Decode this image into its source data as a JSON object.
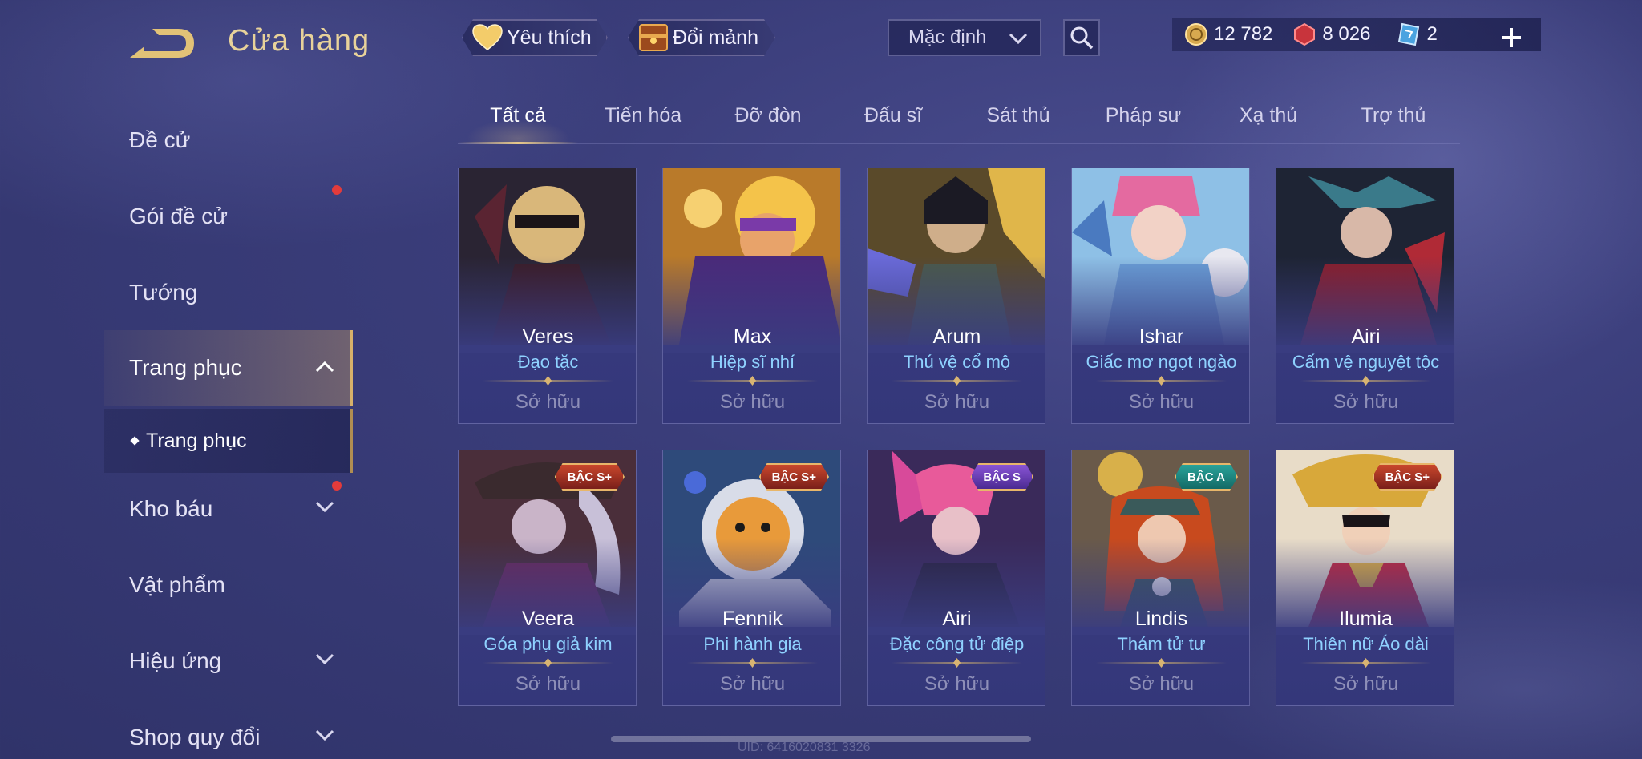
{
  "header": {
    "title": "Cửa hàng",
    "favorite_label": "Yêu thích",
    "swap_label": "Đổi mảnh",
    "sort_value": "Mặc định"
  },
  "currency": {
    "gold": "12 782",
    "red": "8 026",
    "ticket": "2"
  },
  "sidebar": {
    "items": [
      {
        "label": "Đề cử"
      },
      {
        "label": "Gói đề cử"
      },
      {
        "label": "Tướng"
      },
      {
        "label": "Trang phục"
      },
      {
        "label": "Kho báu"
      },
      {
        "label": "Vật phẩm"
      },
      {
        "label": "Hiệu ứng"
      },
      {
        "label": "Shop quy đổi"
      }
    ],
    "sub_item": "Trang phục"
  },
  "tabs": [
    "Tất cả",
    "Tiến hóa",
    "Đỡ đòn",
    "Đấu sĩ",
    "Sát thủ",
    "Pháp sư",
    "Xạ thủ",
    "Trợ thủ"
  ],
  "cards": [
    {
      "hero": "Veres",
      "skin": "Đạo tặc",
      "status": "Sở hữu",
      "tier": ""
    },
    {
      "hero": "Max",
      "skin": "Hiệp sĩ nhí",
      "status": "Sở hữu",
      "tier": ""
    },
    {
      "hero": "Arum",
      "skin": "Thú vệ cổ mộ",
      "status": "Sở hữu",
      "tier": ""
    },
    {
      "hero": "Ishar",
      "skin": "Giấc mơ ngọt ngào",
      "status": "Sở hữu",
      "tier": ""
    },
    {
      "hero": "Airi",
      "skin": "Cấm vệ nguyệt tộc",
      "status": "Sở hữu",
      "tier": ""
    },
    {
      "hero": "Veera",
      "skin": "Góa phụ giả kim",
      "status": "Sở hữu",
      "tier": "BẬC S+"
    },
    {
      "hero": "Fennik",
      "skin": "Phi hành gia",
      "status": "Sở hữu",
      "tier": "BẬC S+"
    },
    {
      "hero": "Airi",
      "skin": "Đặc công tử điệp",
      "status": "Sở hữu",
      "tier": "BẬC S"
    },
    {
      "hero": "Lindis",
      "skin": "Thám tử tư",
      "status": "Sở hữu",
      "tier": "BẬC A"
    },
    {
      "hero": "Ilumia",
      "skin": "Thiên nữ Áo dài",
      "status": "Sở hữu",
      "tier": "BẬC S+"
    }
  ],
  "footer": {
    "uid": "UID: 6416020831 3326"
  },
  "colors": {
    "accent_gold": "#e8d29a",
    "skin_name_blue": "#8fd2ff",
    "owned_gray": "#8e8fb8",
    "notification_red": "#e33b3b"
  }
}
